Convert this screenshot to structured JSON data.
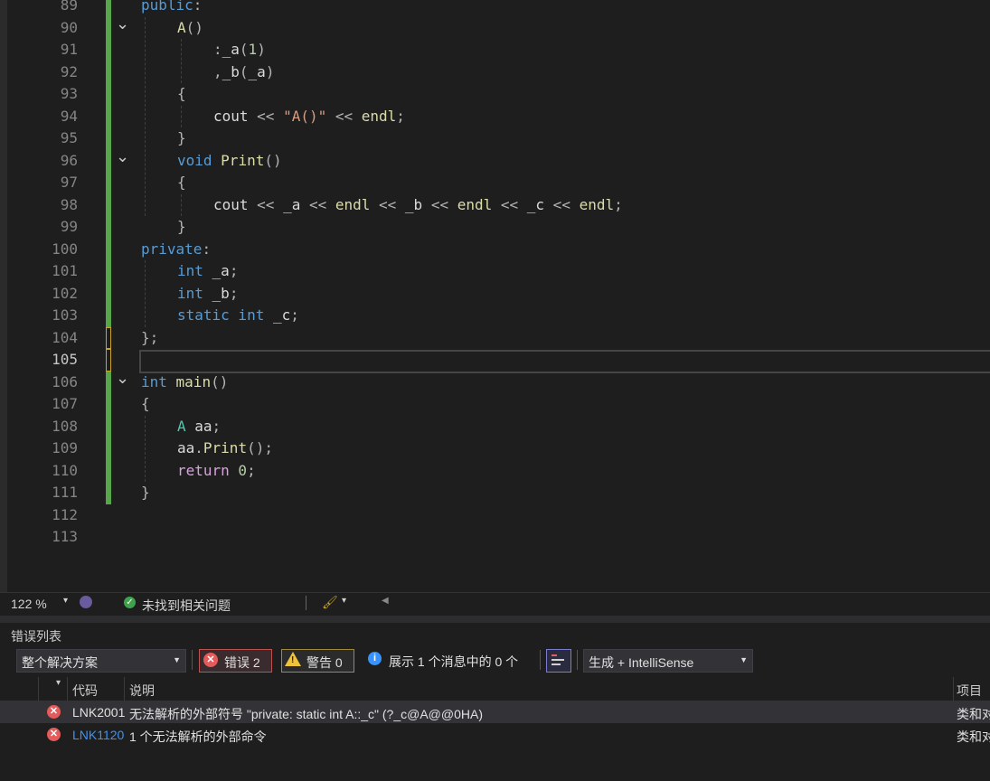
{
  "editor": {
    "lines": [
      {
        "n": "89"
      },
      {
        "n": "90"
      },
      {
        "n": "91"
      },
      {
        "n": "92"
      },
      {
        "n": "93"
      },
      {
        "n": "94"
      },
      {
        "n": "95"
      },
      {
        "n": "96"
      },
      {
        "n": "97"
      },
      {
        "n": "98"
      },
      {
        "n": "99"
      },
      {
        "n": "100"
      },
      {
        "n": "101"
      },
      {
        "n": "102"
      },
      {
        "n": "103"
      },
      {
        "n": "104"
      },
      {
        "n": "105"
      },
      {
        "n": "106"
      },
      {
        "n": "107"
      },
      {
        "n": "108"
      },
      {
        "n": "109"
      },
      {
        "n": "110"
      },
      {
        "n": "111"
      },
      {
        "n": "112"
      },
      {
        "n": "113"
      }
    ],
    "code": {
      "l89_kw": "public",
      "l89_p": ":",
      "l90_fn": "A",
      "l90_p": "()",
      "l91_p1": ":",
      "l91_id": "_a",
      "l91_p2": "(",
      "l91_num": "1",
      "l91_p3": ")",
      "l92_p1": ",",
      "l92_id": "_b",
      "l92_p2": "(",
      "l92_id2": "_a",
      "l92_p3": ")",
      "l93": "{",
      "l94_id": "cout",
      "l94_op": " << ",
      "l94_str": "\"A()\"",
      "l94_op2": " << ",
      "l94_fn": "endl",
      "l94_p": ";",
      "l95": "}",
      "l96_kw": "void",
      "l96_fn": "Print",
      "l96_p": "()",
      "l97": "{",
      "l98_a": "cout",
      "l98_b": " << ",
      "l98_c": "_a",
      "l98_d": " << ",
      "l98_e": "endl",
      "l98_f": " << ",
      "l98_g": "_b",
      "l98_h": " << ",
      "l98_i": "endl",
      "l98_j": " << ",
      "l98_k": "_c",
      "l98_l": " << ",
      "l98_m": "endl",
      "l98_n": ";",
      "l99": "}",
      "l100_kw": "private",
      "l100_p": ":",
      "l101_kw": "int",
      "l101_id": " _a",
      "l101_p": ";",
      "l102_kw": "int",
      "l102_id": " _b",
      "l102_p": ";",
      "l103_kw": "static",
      "l103_kw2": " int",
      "l103_id": " _c",
      "l103_p": ";",
      "l104": "};",
      "l106_kw": "int",
      "l106_fn": " main",
      "l106_p": "()",
      "l107": "{",
      "l108_ty": "A",
      "l108_id": " aa",
      "l108_p": ";",
      "l109_id": "aa",
      "l109_p1": ".",
      "l109_fn": "Print",
      "l109_p2": "();",
      "l110_kw": "return",
      "l110_num": " 0",
      "l110_p": ";",
      "l111": "}"
    }
  },
  "status": {
    "zoom": "122 %",
    "zoom_arrow": "▾",
    "issues": "未找到相关问题",
    "brush_arrow": "▾",
    "scroll_left": "◀"
  },
  "error_list": {
    "title": "错误列表",
    "scope": "整个解决方案",
    "errors_btn": "错误 2",
    "warnings_btn": "警告 0",
    "messages": "展示 1 个消息中的 0 个",
    "source": "生成 + IntelliSense",
    "columns": {
      "code": "代码",
      "description": "说明",
      "project": "项目"
    },
    "rows": [
      {
        "code": "LNK2001",
        "description": "无法解析的外部符号 \"private: static int A::_c\" (?_c@A@@0HA)",
        "project": "类和对象"
      },
      {
        "code": "LNK1120",
        "description": "1 个无法解析的外部命令",
        "project": "类和对象"
      }
    ]
  },
  "colors": {
    "background": "#1e1e1e",
    "keyword": "#569cd6",
    "type": "#4ec9b0",
    "function": "#dcdcaa",
    "string": "#d69d85",
    "number": "#b5cea8",
    "change_bar": "#57a64a",
    "error": "#e55a5a",
    "link": "#3794ff"
  }
}
